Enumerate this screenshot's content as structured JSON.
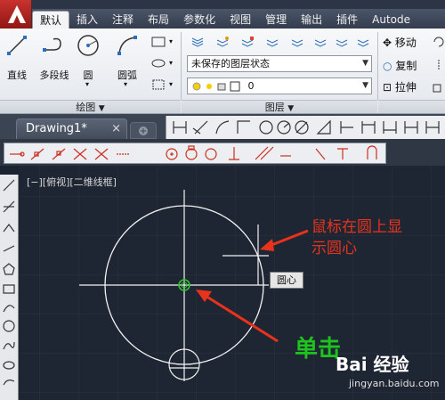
{
  "ribbon": {
    "tabs": [
      "默认",
      "插入",
      "注释",
      "布局",
      "参数化",
      "视图",
      "管理",
      "输出",
      "插件",
      "Autode"
    ],
    "draw": {
      "line": "直线",
      "polyline": "多段线",
      "circle": "圆",
      "arc": "圆弧",
      "panel_label": "绘图"
    },
    "layers": {
      "layer_state": "未保存的图层状态",
      "layer_name": "0",
      "panel_label": "图层"
    },
    "modify": {
      "move": "移动",
      "copy": "复制",
      "stretch": "拉伸"
    }
  },
  "document": {
    "tab_title": "Drawing1*"
  },
  "canvas": {
    "view_label": "[−][俯视][二维线框]",
    "snap_tooltip": "圆心"
  },
  "annotations": {
    "hover_note_line1": "鼠标在圆上显",
    "hover_note_line2": "示圆心",
    "click_note": "单击"
  },
  "watermark": {
    "brand": "Bai 经验",
    "url": "jingyan.baidu.com"
  },
  "colors": {
    "canvas_bg": "#1f2633",
    "annotation_red": "#e8321b",
    "annotation_green": "#1ec31e",
    "snap_marker": "#2ec42e"
  }
}
